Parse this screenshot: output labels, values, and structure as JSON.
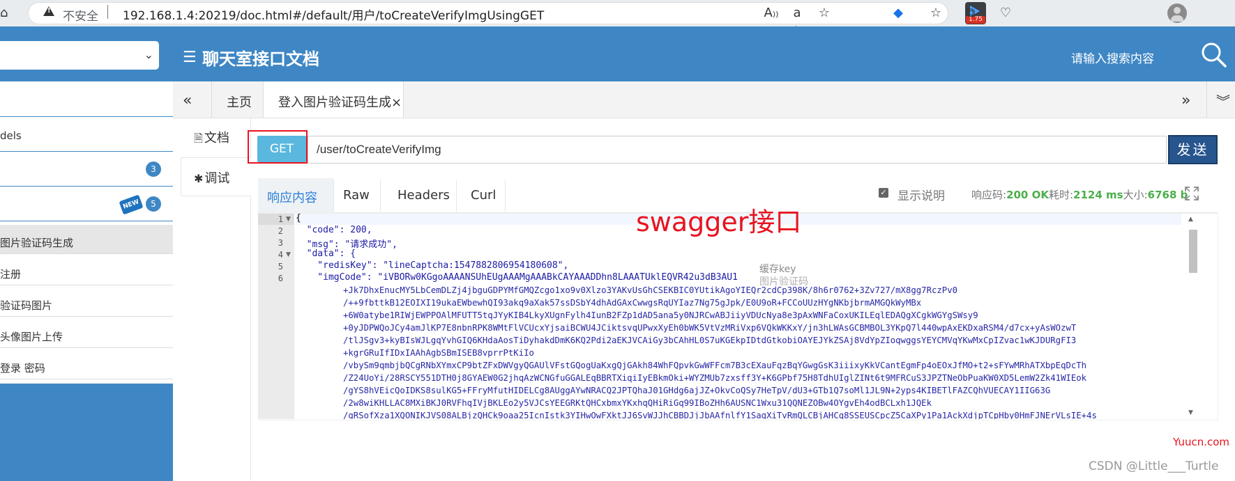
{
  "browser": {
    "insecure_label": "不安全",
    "url": "192.168.1.4:20219/doc.html#/default/用户/toCreateVerifyImgUsingGET",
    "ext_badge": "1.75"
  },
  "header": {
    "title": "聊天室接口文档",
    "search_placeholder": "请输入搜索内容"
  },
  "sidebar": {
    "items": [
      {
        "label": "dels"
      },
      {
        "label": "",
        "badge": "3"
      },
      {
        "label": "",
        "badge": "5",
        "new_label": "NEW"
      },
      {
        "label": "图片验证码生成"
      },
      {
        "label": "注册"
      },
      {
        "label": "验证码图片"
      },
      {
        "label": "头像图片上传"
      },
      {
        "label": "登录 密码"
      }
    ]
  },
  "tabs": {
    "home": "主页",
    "active": "登入图片验证码生成",
    "close": "×"
  },
  "subnav": {
    "doc": "文档",
    "debug": "调试"
  },
  "request": {
    "method": "GET",
    "path": "/user/toCreateVerifyImg",
    "send": "发送"
  },
  "response": {
    "tabs": [
      "响应内容",
      "Raw",
      "Headers",
      "Curl"
    ],
    "show_desc": "显示说明",
    "code_label": "响应码:",
    "code_value": "200 OK",
    "time_label": "耗时:",
    "time_value": "2124 ms",
    "size_label": "大小:",
    "size_value": "6768 b"
  },
  "code": {
    "line_numbers": [
      "1",
      "2",
      "3",
      "4",
      "5",
      "6"
    ],
    "lines": [
      "{",
      "  \"code\": 200,",
      "  \"msg\": \"请求成功\",",
      "  \"data\": {",
      "    \"redisKey\": \"lineCaptcha:1547882806954180608\",",
      "    \"imgCode\": \"iVBORw0KGgoAAAANSUhEUgAAAMgAAABkCAYAAADDhn8LAAATUklEQVR42u3dB3AU1"
    ],
    "b64": [
      "+Jk7DhxEnucMY5LbCemDLZj4jbguGDPYMfGMQZcgo1xo9v0Xlzo3YAKvUsGhCSEKBIC0YUtikAgoYIEQr2cdCp398K/8h6r0762+3Zv727/mX8gg7RczPv0",
      "/++9fbttkB12EOIXI19ukaEWbewhQI93akq9aXak57ssDSbY4dhAdGAxCwwgsRqUYIaz7Ng75gJpk/E0U9oR+FCCoUUzHYgNKbjbrmAMGQkWyMBx",
      "+6W0atybe1RIWjEWPPOAlMFUTT5tqJYyKIB4LkyXUgnFylh4IunB2FZp1dAD5ana5y0NJRCwABJiiyVDUcNya8e3pAxWNFaCoxUKILEqlEDAQgXCgkWGYgSWsy9",
      "+0yJDPWQoJCy4amJlKP7E8nbnRPK8WMtFlVCUcxYjsaiBCWU4JCiktsvqUPwxXyEh0bWK5VtVzMRiVxp6VQkWKKxY/jn3hLWAsGCBMBOL3YKpQ7l440wpAxEKDxaRSM4/d7cx+yAsWOzwT",
      "/tlJSgv3+kyBIsWJLgqYvhGIQ6KHdaAosTiDyhakdDmK6KQ2Pdi2aEKJVCAiGy3bCAhHL0S7uKGEkpIDtdGtkobiOAYEJYkZSAj8VdYpZIoqwggsYEYCMVqYKwMxCpIZvac1wKJDURgFI3",
      "+kgrGRuIfIDxIAAhAgbSBmISEB8vprrPtKiIo",
      "/vbySm9qmbjbQCgRNbXYmxCP9btZFxDWVgyQGAUlVFstGQogUaKxgQjGAkh84WhFQpvkGwWFFcm7B3cEXauFqzBqYGwgGsK3iiixyKkVCantEgmFp4oEOxJfMO+t2+sFYwMRhATXbpEqDcTh",
      "/Z24UoYi/28RSCY551DTH0j8GYAEW0G2jhqAzWCNGfuGGALEqBBRTXiqiIyEBkmOki+WYZMUb7zxsff3Y+K6GPbf75H8TdhUIglZINt6t9MFRCuS3JPZTNeObPuaKW0XD5LemW2Zk41WIEok",
      "/gYS8hVEicQoIDKS8sulKG5+FFryMfutHIDELCg8AUggAYwNRACQ2JPTQhaJ01GHdg6ajJZ+OkvCoQSy7HeTpV/dU3+GTb1Q7soMl1JL9N+2yps4KIBETlFAZCQhVUECAY1IIG63G",
      "/2w8wiKHLLAC8MXiBKJ0RVFhqIVjBKLEo2y5VJCsYEEGRKtQHCxbmxYKxhqQHiRiGq99IBoZHh6AUSNC1Wxu31QQNEZOBw4OYgvEh4odBCLxh1JQEk",
      "/gRSofXza1XQONIKJVS08ALBjzQHCk9oaa25IcnIstk3YIHwOwFXktJJ6SvWJJhCBBDJjJbAAfnlfY1SagXiTvRmQLCBjAHCq8SSEUSCpcZ5CaXPy1Pa1AckXdjpTCpHby0HmFJNErVLsIE+4s"
    ]
  },
  "annotations": {
    "title": "swagger接口",
    "cache": "缓存key",
    "image": "图片验证码"
  },
  "watermarks": {
    "site": "Yuucn.com",
    "csdn": "CSDN @Little___Turtle"
  }
}
